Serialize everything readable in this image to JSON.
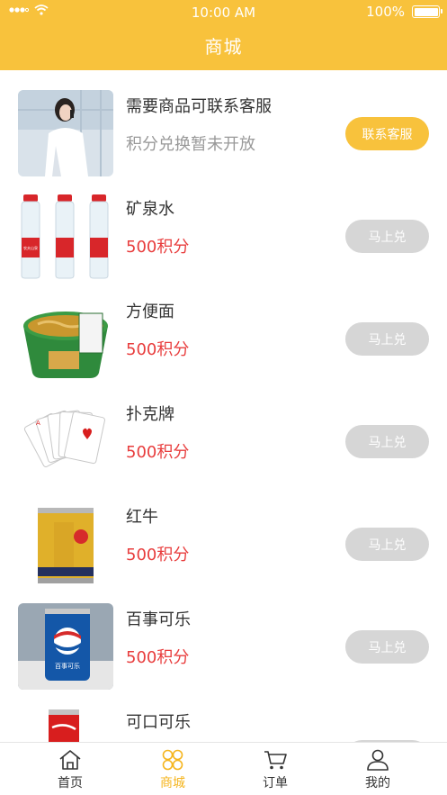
{
  "status_bar": {
    "time": "10:00 AM",
    "battery": "100%"
  },
  "header": {
    "title": "商城"
  },
  "items": [
    {
      "name": "需要商品可联系客服",
      "subtitle": "积分兑换暂未开放",
      "button": "联系客服"
    },
    {
      "name": "矿泉水",
      "subtitle": "500积分",
      "button": "马上兑"
    },
    {
      "name": "方便面",
      "subtitle": "500积分",
      "button": "马上兑"
    },
    {
      "name": "扑克牌",
      "subtitle": "500积分",
      "button": "马上兑"
    },
    {
      "name": "红牛",
      "subtitle": "500积分",
      "button": "马上兑"
    },
    {
      "name": "百事可乐",
      "subtitle": "500积分",
      "button": "马上兑"
    },
    {
      "name": "可口可乐"
    }
  ],
  "product_text": {
    "water_brand": "农夫山泉",
    "pepsi_label": "百事可乐"
  },
  "tabs": [
    {
      "label": "首页",
      "icon": "home-icon"
    },
    {
      "label": "商城",
      "icon": "shop-grid-icon",
      "active": true
    },
    {
      "label": "订单",
      "icon": "cart-icon"
    },
    {
      "label": "我的",
      "icon": "user-icon"
    }
  ],
  "colors": {
    "primary": "#f8c23c",
    "price": "#e83d3d",
    "button_disabled": "#d6d6d6",
    "tab_active": "#f5b51e"
  }
}
